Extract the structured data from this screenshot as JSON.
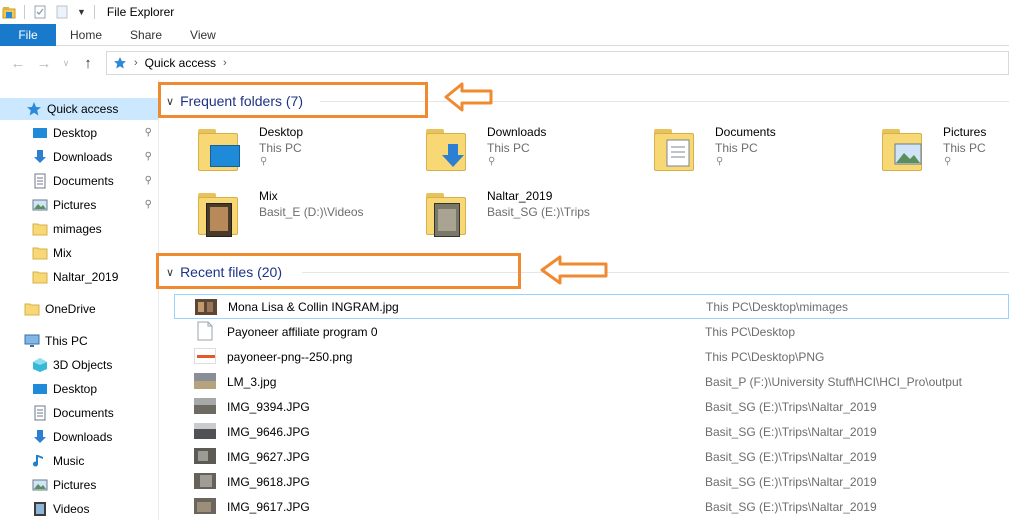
{
  "window": {
    "title": "File Explorer"
  },
  "ribbon": {
    "tabs": [
      "File",
      "Home",
      "Share",
      "View"
    ]
  },
  "address": {
    "crumbs": [
      "Quick access"
    ]
  },
  "nav": {
    "quick_access": "Quick access",
    "pinned": [
      {
        "label": "Desktop",
        "icon": "desktop-icon",
        "pinned": true
      },
      {
        "label": "Downloads",
        "icon": "downloads-icon",
        "pinned": true
      },
      {
        "label": "Documents",
        "icon": "documents-icon",
        "pinned": true
      },
      {
        "label": "Pictures",
        "icon": "pictures-icon",
        "pinned": true
      },
      {
        "label": "mimages",
        "icon": "folder-icon",
        "pinned": false
      },
      {
        "label": "Mix",
        "icon": "folder-icon",
        "pinned": false
      },
      {
        "label": "Naltar_2019",
        "icon": "folder-icon",
        "pinned": false
      }
    ],
    "onedrive": "OneDrive",
    "this_pc": "This PC",
    "this_pc_items": [
      {
        "label": "3D Objects",
        "icon": "3d-objects-icon"
      },
      {
        "label": "Desktop",
        "icon": "desktop-icon"
      },
      {
        "label": "Documents",
        "icon": "documents-icon"
      },
      {
        "label": "Downloads",
        "icon": "downloads-icon"
      },
      {
        "label": "Music",
        "icon": "music-icon"
      },
      {
        "label": "Pictures",
        "icon": "pictures-icon"
      },
      {
        "label": "Videos",
        "icon": "videos-icon"
      }
    ]
  },
  "frequent": {
    "header": "Frequent folders (7)",
    "folders": [
      {
        "name": "Desktop",
        "location": "This PC",
        "pinned": true
      },
      {
        "name": "Downloads",
        "location": "This PC",
        "pinned": true
      },
      {
        "name": "Documents",
        "location": "This PC",
        "pinned": true
      },
      {
        "name": "Pictures",
        "location": "This PC",
        "pinned": true
      },
      {
        "name": "Mix",
        "location": "Basit_E (D:)\\Videos",
        "pinned": false
      },
      {
        "name": "Naltar_2019",
        "location": "Basit_SG (E:)\\Trips",
        "pinned": false
      }
    ]
  },
  "recent": {
    "header": "Recent files (20)",
    "files": [
      {
        "name": "Mona Lisa & Collin INGRAM.jpg",
        "path": "This PC\\Desktop\\mimages"
      },
      {
        "name": "Payoneer affiliate program 0",
        "path": "This PC\\Desktop"
      },
      {
        "name": "payoneer-png--250.png",
        "path": "This PC\\Desktop\\PNG"
      },
      {
        "name": "LM_3.jpg",
        "path": "Basit_P (F:)\\University Stuff\\HCI\\HCI_Pro\\output"
      },
      {
        "name": "IMG_9394.JPG",
        "path": "Basit_SG (E:)\\Trips\\Naltar_2019"
      },
      {
        "name": "IMG_9646.JPG",
        "path": "Basit_SG (E:)\\Trips\\Naltar_2019"
      },
      {
        "name": "IMG_9627.JPG",
        "path": "Basit_SG (E:)\\Trips\\Naltar_2019"
      },
      {
        "name": "IMG_9618.JPG",
        "path": "Basit_SG (E:)\\Trips\\Naltar_2019"
      },
      {
        "name": "IMG_9617.JPG",
        "path": "Basit_SG (E:)\\Trips\\Naltar_2019"
      }
    ]
  },
  "colors": {
    "accent": "#1979ca",
    "annotation": "#f08a30",
    "selection": "#cce8ff",
    "header_text": "#1e3287"
  }
}
